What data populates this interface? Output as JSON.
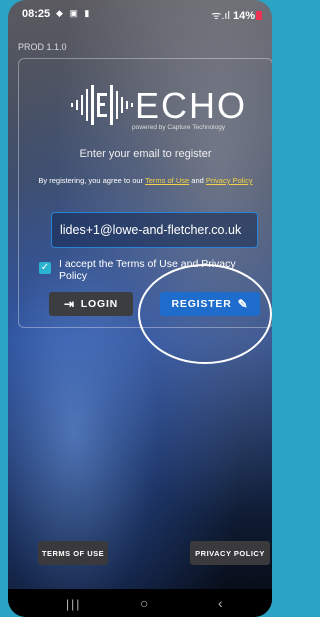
{
  "status_bar": {
    "time": "08:25",
    "left_icons": "◆ ▣ ▮",
    "signal": "ᯤ.ıl",
    "battery_pct": "14%"
  },
  "build_label": "PROD 1.1.0",
  "logo": {
    "name": "ECHO",
    "powered_by": "powered by Capture Technology"
  },
  "subtitle": "Enter your email to register",
  "agreement": {
    "prefix": "By registering, you agree to our ",
    "terms_link": "Terms of Use",
    "middle": " and ",
    "privacy_link": "Privacy Policy"
  },
  "email_input": {
    "value": "lides+1@lowe-and-fletcher.co.uk"
  },
  "accept_checkbox": {
    "checked": true,
    "label": "I accept the Terms of Use and Privacy Policy"
  },
  "buttons": {
    "login": "LOGIN",
    "register": "REGISTER"
  },
  "footer": {
    "terms": "TERMS OF USE",
    "privacy": "PRIVACY POLICY"
  },
  "navbar": {
    "recent": "|||",
    "home": "○",
    "back": "‹"
  },
  "colors": {
    "accent": "#1e6ccc",
    "link": "#f3d24a",
    "checkbox": "#2ab3d0"
  }
}
